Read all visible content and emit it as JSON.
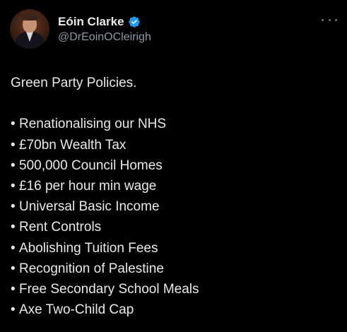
{
  "author": {
    "display_name": "Eóin Clarke",
    "handle": "@DrEoinOCleirigh",
    "verified": true
  },
  "tweet": {
    "intro": "Green Party Policies.",
    "bullet_char": "•",
    "policies": [
      "Renationalising our NHS",
      "£70bn Wealth Tax",
      "500,000 Council Homes",
      "£16 per hour min wage",
      "Universal Basic Income",
      "Rent Controls",
      "Abolishing Tuition Fees",
      "Recognition of Palestine",
      "Free Secondary School Meals",
      "Axe Two-Child Cap"
    ]
  },
  "colors": {
    "background": "#000000",
    "text_primary": "#e7e9ea",
    "text_secondary": "#8b98a5",
    "verified_badge": "#1d9bf0"
  },
  "icons": {
    "verified": "verified-badge-icon",
    "more": "more-options-icon"
  }
}
